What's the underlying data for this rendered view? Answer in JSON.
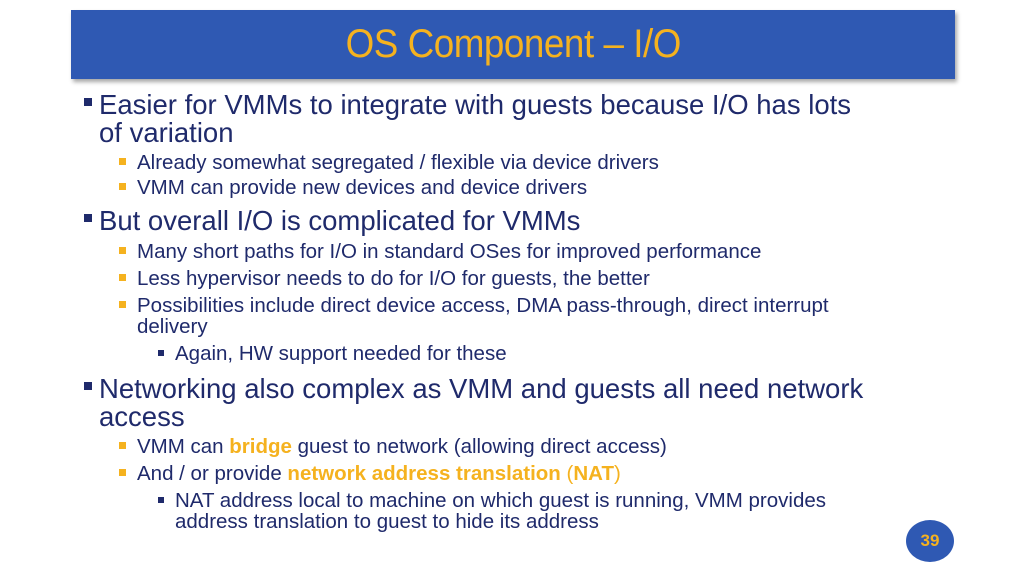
{
  "slide": {
    "title": "OS Component – I/O",
    "page_number": "39",
    "colors": {
      "title_bar": "#2f59b3",
      "accent": "#f5b21f",
      "text": "#1f2a6b"
    }
  },
  "bullets": {
    "b1": {
      "line1": "Easier for VMMs to integrate with guests because I/O has lots",
      "line2": "of variation",
      "sub": [
        "Already somewhat segregated / flexible via device drivers",
        "VMM can provide new devices and device drivers"
      ]
    },
    "b2": {
      "line1": "But overall I/O is complicated for VMMs",
      "sub": [
        "Many short paths for I/O in standard OSes for improved performance",
        "Less hypervisor needs to do for I/O for guests, the better"
      ],
      "sub3_line1": "Possibilities include direct device access, DMA pass-through, direct interrupt",
      "sub3_line2": "delivery",
      "subsub": "Again, HW support needed for these"
    },
    "b3": {
      "line1": "Networking also complex as VMM and guests all need network",
      "line2": "access",
      "sub1": {
        "pre": "VMM can ",
        "hl": "bridge",
        "post": " guest to network (allowing direct access)"
      },
      "sub2": {
        "pre": "And / or provide ",
        "hl": "network address translation",
        "mid": " (",
        "hl2": "NAT",
        "post": ")"
      },
      "subsub_line1": "NAT address local to machine on which guest is running, VMM provides",
      "subsub_line2": "address translation to guest to hide its address"
    }
  }
}
